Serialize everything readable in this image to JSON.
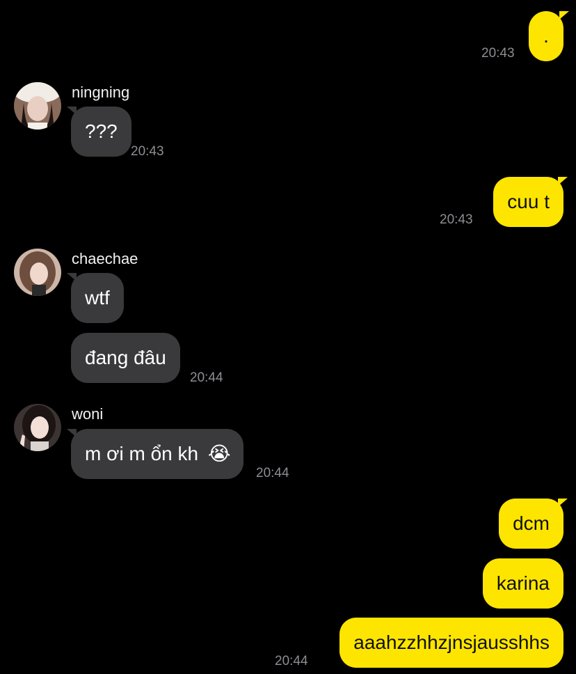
{
  "messages": [
    {
      "from": "me",
      "text": ".",
      "time": "20:43"
    },
    {
      "from": "ningning",
      "name": "ningning",
      "text": "???",
      "time": "20:43",
      "avatar": "avatar-photo"
    },
    {
      "from": "me",
      "text": "cuu t",
      "time": "20:43"
    },
    {
      "from": "chaechae",
      "name": "chaechae",
      "texts": [
        "wtf",
        "đang đâu"
      ],
      "time": "20:44",
      "avatar": "avatar-photo"
    },
    {
      "from": "woni",
      "name": "woni",
      "text": "m ơi m ổn kh",
      "emoji": "😭",
      "time": "20:44",
      "avatar": "avatar-photo"
    },
    {
      "from": "me",
      "texts": [
        "dcm",
        "karina",
        "aaahzzhhzjnsjausshhs"
      ],
      "time": "20:44"
    }
  ],
  "colors": {
    "background": "#000000",
    "outgoing_bubble": "#fee500",
    "incoming_bubble": "#3a3a3c",
    "timestamp": "#8e8e93"
  }
}
